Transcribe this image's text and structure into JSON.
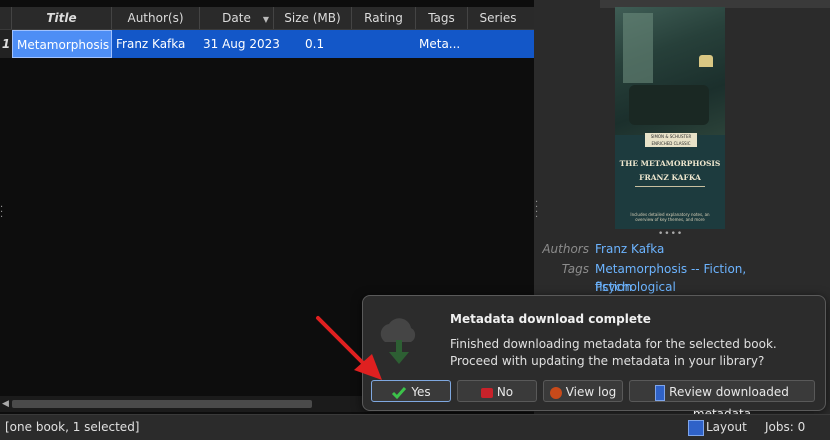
{
  "table": {
    "columns": [
      {
        "label": "Title"
      },
      {
        "label": "Author(s)"
      },
      {
        "label": "Date"
      },
      {
        "label": "Size (MB)"
      },
      {
        "label": "Rating"
      },
      {
        "label": "Tags"
      },
      {
        "label": "Series"
      }
    ],
    "rows": [
      {
        "num": "1",
        "title": "Metamorphosis",
        "author": "Franz Kafka",
        "date": "31 Aug 2023",
        "size": "0.1",
        "rating": "",
        "tags": "Meta...",
        "series": ""
      }
    ]
  },
  "details": {
    "cover": {
      "badge": "SIMON & SCHUSTER ENRICHED CLASSIC",
      "title": "THE METAMORPHOSIS",
      "author": "FRANZ KAFKA",
      "blurb": "Includes detailed explanatory notes, an overview of key themes, and more"
    },
    "authors_label": "Authors",
    "authors_value": "Franz Kafka",
    "tags_label": "Tags",
    "tags_value_line1": "Metamorphosis -- Fiction, Psychological",
    "tags_value_line2": "fiction"
  },
  "popup": {
    "title": "Metadata download complete",
    "message": "Finished downloading metadata for the selected book. Proceed with updating the metadata in your library?",
    "buttons": {
      "yes": "Yes",
      "no": "No",
      "view_log": "View log",
      "review": "Review downloaded metadata"
    }
  },
  "status": {
    "left": "[one book, 1 selected]",
    "layout": "Layout",
    "jobs": "Jobs: 0"
  },
  "colors": {
    "selection": "#1357c8",
    "selected_cell": "#4e8ef5",
    "link": "#6cb4ff",
    "arrow": "#e02020"
  }
}
